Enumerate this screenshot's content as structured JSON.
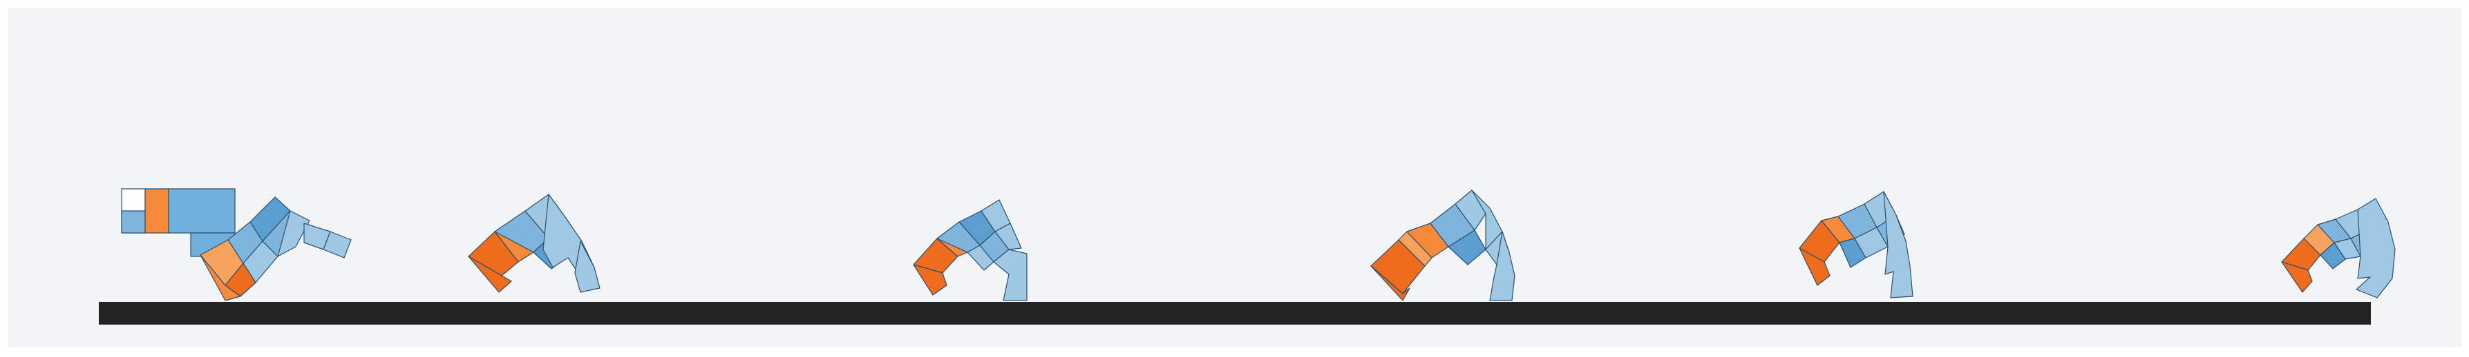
{
  "scene": {
    "background_color": "#f3f4f6",
    "ground_color": "#242424",
    "palette": {
      "blue_light": "#9ec8e4",
      "blue_mid": "#7fb5dc",
      "blue_dark": "#5a9fd0",
      "orange_light": "#f7a25d",
      "orange_mid": "#f68a3a",
      "orange_dark": "#ef6c1c"
    },
    "frame_count": 6
  }
}
